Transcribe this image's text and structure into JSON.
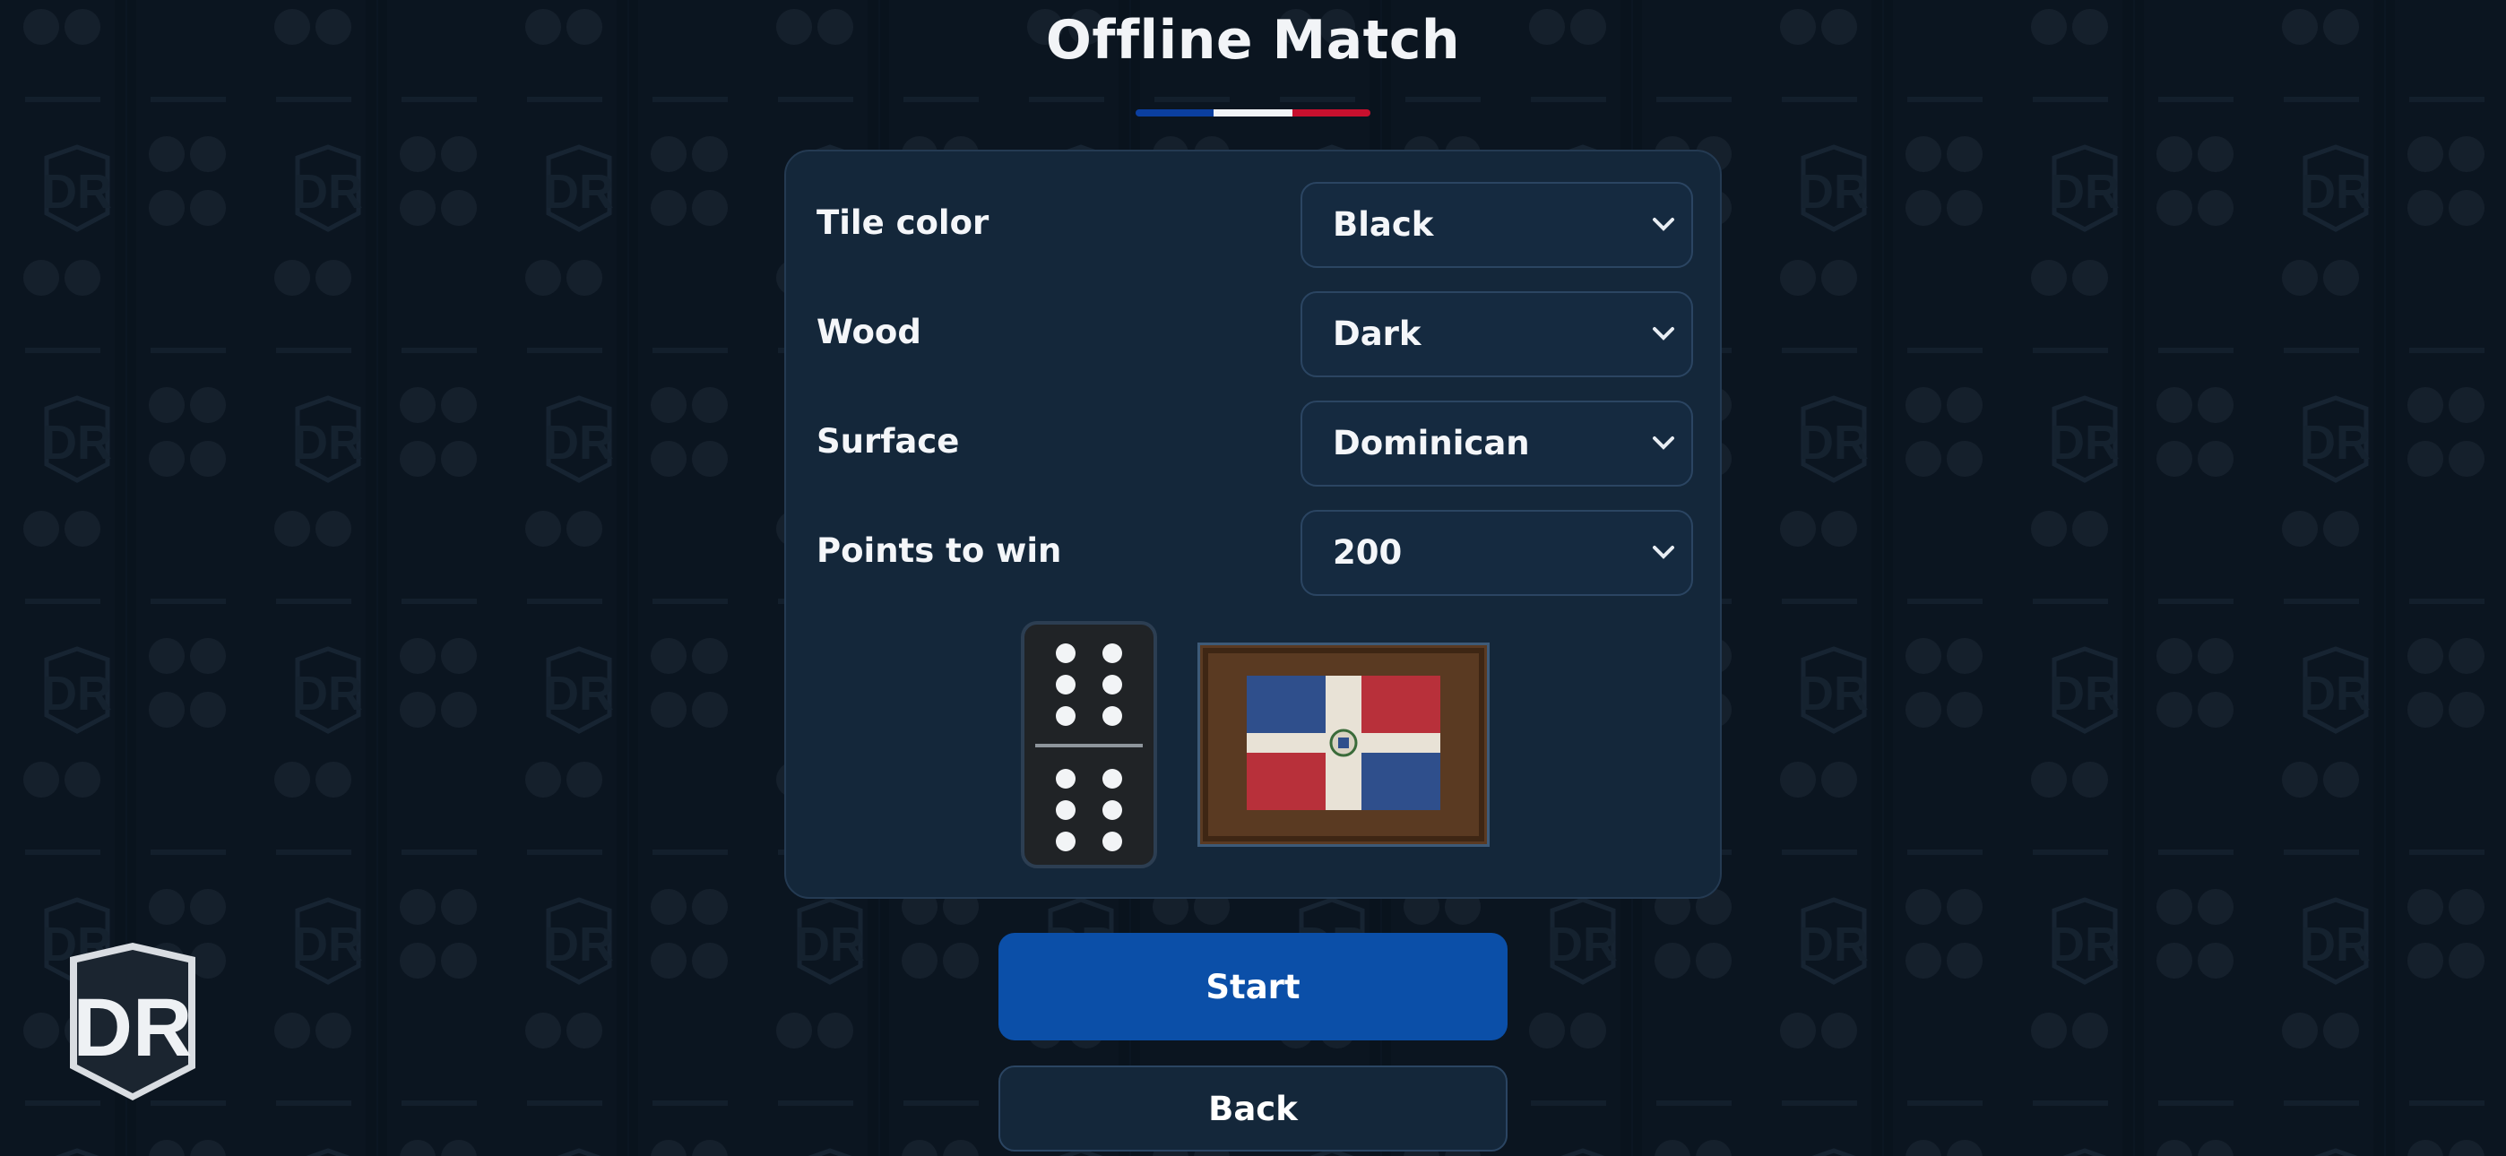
{
  "screen": {
    "title": "Offline Match",
    "flag_colors": [
      "#0b3fa0",
      "#f2f4f7",
      "#c8102e"
    ]
  },
  "settings": [
    {
      "label": "Tile color",
      "value": "Black"
    },
    {
      "label": "Wood",
      "value": "Dark"
    },
    {
      "label": "Surface",
      "value": "Dominican"
    },
    {
      "label": "Points to win",
      "value": "200"
    }
  ],
  "preview": {
    "domino_top_pips": 6,
    "domino_bottom_pips": 6,
    "surface_image": "dominican-flag-table"
  },
  "buttons": {
    "start": "Start",
    "back": "Back"
  },
  "logo": {
    "text": "DR"
  },
  "icons": {
    "dropdown": "chevron-down-icon"
  }
}
